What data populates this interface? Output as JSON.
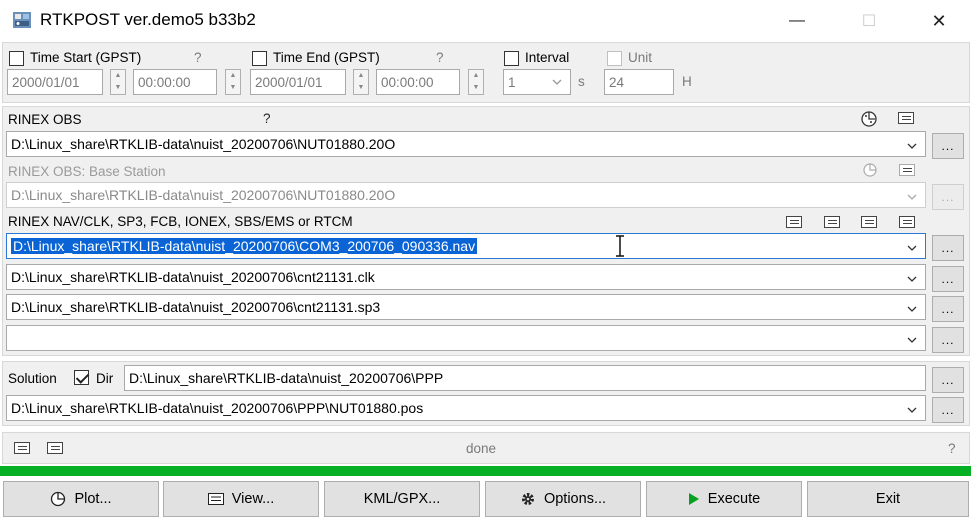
{
  "window": {
    "title": "RTKPOST ver.demo5 b33b2",
    "controls": {
      "minimize": "—",
      "maximize": "☐",
      "close": "✕"
    }
  },
  "time": {
    "start_label": "Time Start (GPST)",
    "start_help": "?",
    "start_date": "2000/01/01",
    "start_time": "00:00:00",
    "end_label": "Time End (GPST)",
    "end_help": "?",
    "end_date": "2000/01/01",
    "end_time": "00:00:00",
    "interval_label": "Interval",
    "interval_value": "1",
    "interval_unit": "s",
    "unit_label": "Unit",
    "unit_value": "24",
    "unit_suffix": "H"
  },
  "inputs": {
    "rover_label": "RINEX OBS",
    "rover_help": "?",
    "rover_path": "D:\\Linux_share\\RTKLIB-data\\nuist_20200706\\NUT01880.20O",
    "base_label": "RINEX OBS: Base Station",
    "base_path": "D:\\Linux_share\\RTKLIB-data\\nuist_20200706\\NUT01880.20O",
    "nav_label": "RINEX NAV/CLK, SP3, FCB, IONEX, SBS/EMS  or RTCM",
    "nav_files": [
      "D:\\Linux_share\\RTKLIB-data\\nuist_20200706\\COM3_200706_090336.nav",
      "D:\\Linux_share\\RTKLIB-data\\nuist_20200706\\cnt21131.clk",
      "D:\\Linux_share\\RTKLIB-data\\nuist_20200706\\cnt21131.sp3",
      ""
    ],
    "browse": "..."
  },
  "solution": {
    "label": "Solution",
    "dir_label": "Dir",
    "dir_path": "D:\\Linux_share\\RTKLIB-data\\nuist_20200706\\PPP",
    "out_path": "D:\\Linux_share\\RTKLIB-data\\nuist_20200706\\PPP\\NUT01880.pos"
  },
  "status": {
    "message": "done",
    "help": "?",
    "progress": 1.0,
    "progress_color": "#06b025"
  },
  "buttons": {
    "plot": "Plot...",
    "view": "View...",
    "kml": "KML/GPX...",
    "options": "Options...",
    "execute": "Execute",
    "exit": "Exit"
  },
  "colors": {
    "selection": "#0a64d6",
    "execute_arrow": "#08a020"
  }
}
